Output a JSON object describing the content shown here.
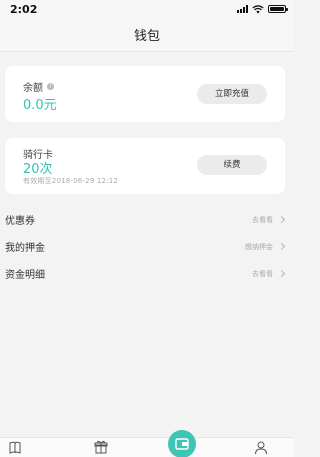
{
  "status_bar": {
    "time": "2:02"
  },
  "nav": {
    "title": "钱包"
  },
  "balance_card": {
    "label": "余额",
    "value": "0.0元",
    "button": "立即充值",
    "info_icon": "info-icon"
  },
  "ride_card": {
    "label": "骑行卡",
    "value": "20次",
    "expiry": "有效期至2018-06-29 12:12",
    "button": "续费"
  },
  "list": {
    "items": [
      {
        "label": "优惠券",
        "hint": "去看看"
      },
      {
        "label": "我的押金",
        "hint": "缴纳押金"
      },
      {
        "label": "资金明细",
        "hint": "去看看"
      }
    ]
  },
  "tab_bar": {
    "tabs": [
      {
        "icon": "book-icon"
      },
      {
        "icon": "gift-icon"
      },
      {
        "icon": "wallet-icon"
      },
      {
        "icon": "user-icon"
      }
    ]
  },
  "colors": {
    "accent": "#37c1b4",
    "background": "#f3f3f3",
    "card": "#ffffff",
    "button": "#ebebeb"
  }
}
